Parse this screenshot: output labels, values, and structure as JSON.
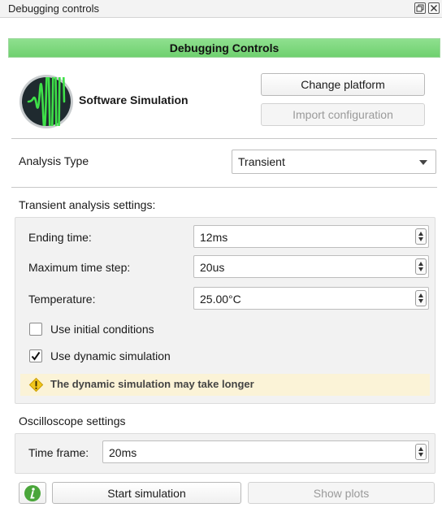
{
  "window": {
    "title": "Debugging controls"
  },
  "header": {
    "title": "Debugging Controls"
  },
  "platform": {
    "name": "Software Simulation",
    "change_platform_label": "Change platform",
    "import_configuration_label": "Import configuration"
  },
  "analysis": {
    "label": "Analysis Type",
    "selected": "Transient"
  },
  "transient": {
    "section_title": "Transient analysis settings:",
    "ending_time_label": "Ending time:",
    "ending_time_value": "12ms",
    "max_step_label": "Maximum time step:",
    "max_step_value": "20us",
    "temperature_label": "Temperature:",
    "temperature_value": "25.00°C",
    "initial_conditions_label": "Use initial conditions",
    "initial_conditions_checked": false,
    "dynamic_simulation_label": "Use dynamic simulation",
    "dynamic_simulation_checked": true,
    "warning_text": "The dynamic simulation may take longer"
  },
  "oscilloscope": {
    "section_title": "Oscilloscope settings",
    "time_frame_label": "Time frame:",
    "time_frame_value": "20ms"
  },
  "footer": {
    "start_label": "Start simulation",
    "show_plots_label": "Show plots"
  },
  "colors": {
    "header_green": "#7ed87e",
    "warning_bg": "#fbf3d7",
    "warning_icon": "#f2c71c",
    "info_green": "#4aa63a",
    "waveform": "#3ee048"
  },
  "icons": [
    "restore-icon",
    "close-icon",
    "waveform-logo-icon",
    "dropdown-arrow-icon",
    "warning-icon",
    "info-icon",
    "check-icon"
  ]
}
